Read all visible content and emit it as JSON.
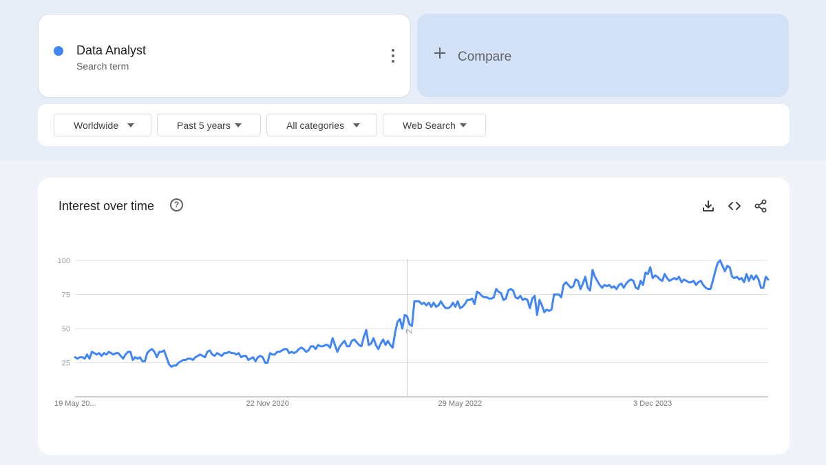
{
  "search_term": {
    "name": "Data Analyst",
    "subtitle": "Search term",
    "color": "#4285f4"
  },
  "compare": {
    "label": "Compare"
  },
  "filters": [
    {
      "label": "Worldwide"
    },
    {
      "label": "Past 5 years"
    },
    {
      "label": "All categories"
    },
    {
      "label": "Web Search"
    }
  ],
  "chart": {
    "title": "Interest over time",
    "icons": [
      "download-icon",
      "embed-code-icon",
      "share-icon",
      "help-icon"
    ]
  },
  "chart_data": {
    "type": "line",
    "title": "Interest over time",
    "xlabel": "",
    "ylabel": "",
    "ylim": [
      0,
      100
    ],
    "y_ticks": [
      "25",
      "50",
      "75",
      "100"
    ],
    "y_tick_values": [
      25,
      50,
      75,
      100
    ],
    "x_tick_labels": [
      "19 May 20...",
      "22 Nov 2020",
      "29 May 2022",
      "3 Dec 2023"
    ],
    "x_tick_weeks": [
      0,
      80,
      160,
      240
    ],
    "note_marker": "2",
    "note_week": 138,
    "grid": true,
    "series": [
      {
        "color": "#4285f4",
        "values": [
          29,
          28,
          29,
          29,
          28,
          31,
          28,
          33,
          32,
          31,
          32,
          30,
          32,
          31,
          33,
          32,
          31,
          32,
          32,
          30,
          28,
          31,
          33,
          33,
          27,
          29,
          28,
          29,
          26,
          26,
          32,
          34,
          35,
          33,
          29,
          33,
          33,
          34,
          29,
          24,
          22,
          23,
          23,
          25,
          26,
          27,
          27,
          28,
          28,
          27,
          29,
          30,
          31,
          30,
          29,
          33,
          34,
          31,
          30,
          32,
          31,
          30,
          32,
          32,
          33,
          32,
          32,
          31,
          32,
          29,
          30,
          30,
          27,
          28,
          29,
          26,
          29,
          30,
          29,
          25,
          25,
          32,
          31,
          31,
          33,
          33,
          34,
          35,
          35,
          32,
          33,
          32,
          33,
          35,
          36,
          35,
          33,
          34,
          37,
          37,
          35,
          38,
          37,
          37,
          38,
          38,
          36,
          43,
          38,
          33,
          37,
          39,
          41,
          37,
          37,
          41,
          42,
          40,
          38,
          37,
          44,
          49,
          38,
          39,
          43,
          38,
          35,
          39,
          42,
          38,
          41,
          38,
          36,
          47,
          55,
          57,
          50,
          60,
          59,
          53,
          52,
          70,
          70,
          70,
          68,
          69,
          67,
          69,
          66,
          69,
          66,
          67,
          70,
          67,
          65,
          65,
          66,
          69,
          66,
          70,
          65,
          66,
          68,
          71,
          71,
          72,
          68,
          77,
          76,
          74,
          73,
          73,
          72,
          72,
          73,
          79,
          77,
          76,
          71,
          72,
          78,
          79,
          78,
          73,
          72,
          74,
          71,
          72,
          71,
          65,
          72,
          74,
          60,
          71,
          67,
          62,
          64,
          63,
          64,
          75,
          75,
          75,
          73,
          82,
          84,
          82,
          80,
          81,
          86,
          85,
          79,
          83,
          88,
          80,
          78,
          93,
          88,
          85,
          82,
          80,
          82,
          81,
          82,
          80,
          81,
          79,
          82,
          83,
          80,
          83,
          85,
          86,
          85,
          80,
          79,
          85,
          82,
          91,
          90,
          95,
          87,
          89,
          88,
          86,
          85,
          90,
          87,
          85,
          86,
          87,
          86,
          88,
          84,
          86,
          85,
          84,
          84,
          85,
          82,
          84,
          85,
          82,
          80,
          79,
          79,
          85,
          92,
          98,
          100,
          96,
          92,
          96,
          95,
          88,
          87,
          88,
          86,
          87,
          84,
          90,
          85,
          89,
          86,
          89,
          86,
          80,
          80,
          88,
          86
        ]
      }
    ]
  }
}
